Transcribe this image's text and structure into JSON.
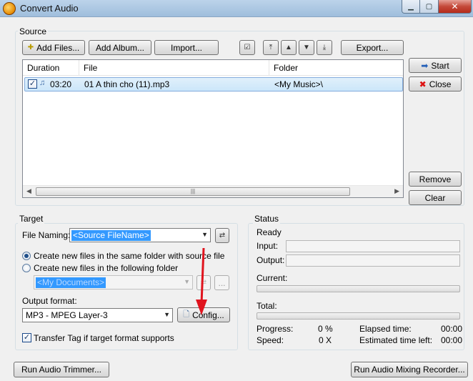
{
  "window": {
    "title": "Convert Audio"
  },
  "source": {
    "label": "Source",
    "buttons": {
      "add_files": "Add Files...",
      "add_album": "Add Album...",
      "import": "Import...",
      "export": "Export..."
    },
    "columns": [
      "Duration",
      "File",
      "Folder"
    ],
    "rows": [
      {
        "checked": true,
        "duration": "03:20",
        "file": "01 A thin cho (11).mp3",
        "folder": "<My Music>\\"
      }
    ]
  },
  "side_buttons": {
    "start": "Start",
    "close": "Close",
    "remove": "Remove",
    "clear": "Clear"
  },
  "target": {
    "label": "Target",
    "file_naming_label": "File Naming:",
    "file_naming_value": "<Source FileName>",
    "radio_same_folder": "Create new files in the same folder with source file",
    "radio_following_folder": "Create new files in the following folder",
    "folder_value": "<My Documents>",
    "selected_radio": "same_folder",
    "output_format_label": "Output format:",
    "output_format_value": "MP3 - MPEG Layer-3",
    "config_button": "Config...",
    "browse_button": "...",
    "transfer_tag_label": "Transfer Tag if target format supports",
    "transfer_tag_checked": true
  },
  "status": {
    "label": "Status",
    "state": "Ready",
    "input_label": "Input:",
    "output_label": "Output:",
    "current_label": "Current:",
    "total_label": "Total:",
    "progress_label": "Progress:",
    "progress_value": "0 %",
    "speed_label": "Speed:",
    "speed_value": "0 X",
    "elapsed_label": "Elapsed time:",
    "elapsed_value": "00:00",
    "estimated_label": "Estimated time left:",
    "estimated_value": "00:00",
    "current_progress": 0,
    "total_progress": 0
  },
  "bottom_buttons": {
    "trimmer": "Run Audio Trimmer...",
    "recorder": "Run Audio Mixing Recorder..."
  },
  "colors": {
    "selection": "#3399ff",
    "annotation_arrow": "#e0141e",
    "row_highlight": "#cbe6fa"
  },
  "icons": {
    "start": "blue-right-arrow-icon",
    "close": "red-x-icon",
    "add_files": "plus-icon",
    "config": "document-icon",
    "file_naming_swap": "swap-arrows-icon"
  }
}
